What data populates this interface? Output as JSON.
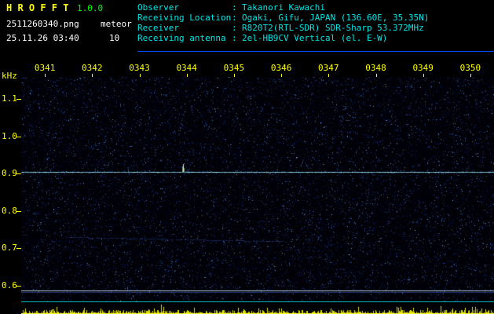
{
  "window": {
    "title": "H R O F F T",
    "version": "1.0.0",
    "filename": "2511260340.png",
    "mode": "meteor",
    "timestamp": "25.11.26 03:40",
    "interval": "10"
  },
  "info": {
    "rows": [
      {
        "label": "Observer",
        "value": "Takanori Kawachi"
      },
      {
        "label": "Receiving Location",
        "value": "Ogaki, Gifu, JAPAN (136.60E, 35.35N)"
      },
      {
        "label": "Receiver",
        "value": "R820T2(RTL-SDR) SDR-Sharp 53.372MHz"
      },
      {
        "label": "Receiving antenna",
        "value": "2el-HB9CV Vertical (el. E-W)"
      }
    ]
  },
  "chart_data": {
    "type": "heatmap",
    "description": "Radio meteor echo spectrogram (10-minute waterfall) with signal-level strip below",
    "x_ticks": [
      "0341",
      "0342",
      "0343",
      "0344",
      "0345",
      "0346",
      "0347",
      "0348",
      "0349",
      "0350"
    ],
    "x_range_hhmm": [
      "0340",
      "0350"
    ],
    "y_label": "kHz",
    "y_ticks": [
      "1.1",
      "1.0",
      "0.9",
      "0.8",
      "0.7",
      "0.6"
    ],
    "y_range_khz": [
      0.57,
      1.16
    ],
    "features": [
      {
        "name": "carrier-line",
        "freq_khz": 0.91,
        "extent": "full-width",
        "color": "#a0ebff"
      },
      {
        "name": "meteor-echo-blip",
        "time": "0344",
        "freq_khz": 0.93
      },
      {
        "name": "faint-drift-line",
        "freq_khz": 0.72,
        "time_span": [
          "0341",
          "0346"
        ]
      },
      {
        "name": "reference-line",
        "freq_khz": 0.59,
        "extent": "full-width",
        "color": "#bed2e6"
      }
    ],
    "bottom_strip": {
      "name": "signal-level-meter",
      "spike_color": "#ffff00",
      "background": "#000000"
    },
    "colors": {
      "background": "#000000",
      "noise": "#1030a0",
      "carrier": "#a0ebff",
      "axis_text": "#ffff00",
      "header_text": "#00e6e6",
      "title": "#ffff00",
      "version": "#00ff00",
      "file_text": "#ffffff",
      "separator_line": "#0044ff"
    }
  }
}
